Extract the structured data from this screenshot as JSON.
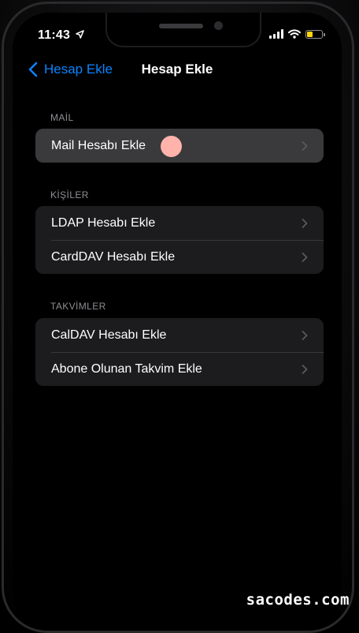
{
  "status_bar": {
    "time": "11:43",
    "location_icon": "location-arrow-icon",
    "battery_color": "#ffd60a",
    "battery_level": 0.45
  },
  "nav": {
    "back_label": "Hesap Ekle",
    "title": "Hesap Ekle",
    "accent": "#0a84ff"
  },
  "sections": [
    {
      "header": "MAİL",
      "rows": [
        {
          "label": "Mail Hesabı Ekle",
          "highlighted": true
        }
      ]
    },
    {
      "header": "KİŞİLER",
      "rows": [
        {
          "label": "LDAP Hesabı Ekle"
        },
        {
          "label": "CardDAV Hesabı Ekle"
        }
      ]
    },
    {
      "header": "TAKVİMLER",
      "rows": [
        {
          "label": "CalDAV Hesabı Ekle"
        },
        {
          "label": "Abone Olunan Takvim Ekle"
        }
      ]
    }
  ],
  "tap_indicator_color": "#ffb3ab",
  "watermark": "sacodes.com"
}
